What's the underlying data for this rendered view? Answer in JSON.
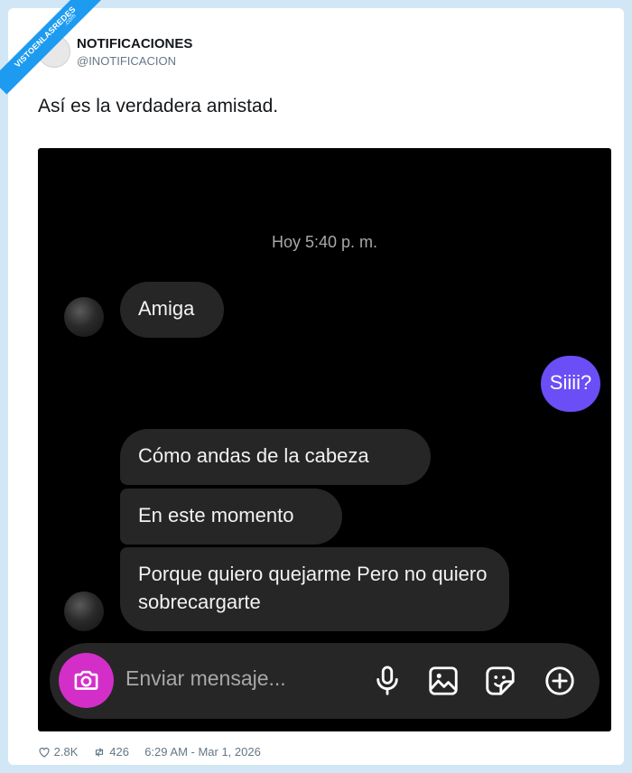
{
  "watermark": {
    "text": "VISTOENLASREDES",
    "sub": ".com"
  },
  "tweet": {
    "author_name": "NOTIFICACIONES",
    "author_handle": "@INOTIFICACION",
    "text": "Así es la verdadera amistad."
  },
  "chat": {
    "timestamp": "Hoy 5:40 p. m.",
    "messages": [
      {
        "from": "them",
        "text": "Amiga"
      },
      {
        "from": "me",
        "text": "Siiii?"
      },
      {
        "from": "them",
        "text": "Cómo andas de la cabeza"
      },
      {
        "from": "them",
        "text": "En este momento"
      },
      {
        "from": "them",
        "text": "Porque quiero quejarme Pero no quiero sobrecargarte"
      }
    ],
    "input_placeholder": "Enviar mensaje...",
    "accent_color": "#6b4ef5",
    "camera_color": "#d42ec9",
    "icons": [
      "camera-icon",
      "microphone-icon",
      "image-icon",
      "sticker-icon",
      "plus-circle-icon"
    ]
  },
  "footer": {
    "likes": "2.8K",
    "retweets": "426",
    "datetime": "6:29 AM - Mar 1, 2026"
  }
}
